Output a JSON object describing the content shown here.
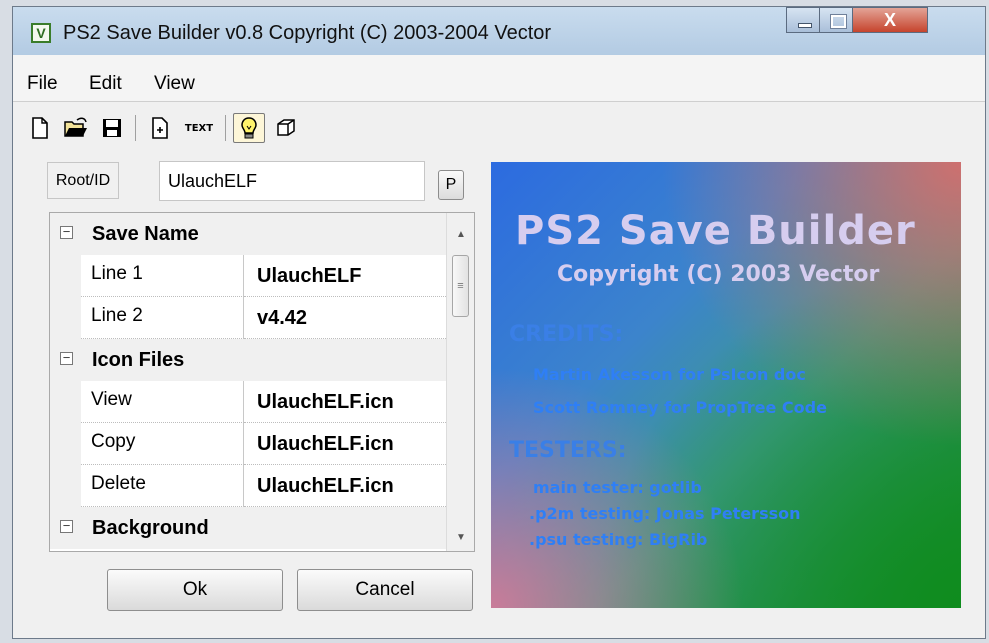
{
  "window": {
    "title": "PS2 Save Builder v0.8 Copyright (C) 2003-2004 Vector",
    "app_icon_letter": "V",
    "close_glyph": "X"
  },
  "menu": [
    "File",
    "Edit",
    "View"
  ],
  "toolbar": {
    "text_button_label": "TEXT",
    "icons": [
      "new-file-icon",
      "open-folder-icon",
      "save-icon",
      "new-item-icon",
      "text-icon",
      "lightbulb-icon",
      "cube-icon"
    ]
  },
  "root": {
    "label": "Root/ID",
    "value": "UlauchELF",
    "p_button": "P"
  },
  "properties": {
    "save_name": {
      "title": "Save Name",
      "rows": [
        {
          "name": "Line 1",
          "value": "UlauchELF"
        },
        {
          "name": "Line 2",
          "value": "v4.42"
        }
      ]
    },
    "icon_files": {
      "title": "Icon Files",
      "rows": [
        {
          "name": "View",
          "value": "UlauchELF.icn"
        },
        {
          "name": "Copy",
          "value": "UlauchELF.icn"
        },
        {
          "name": "Delete",
          "value": "UlauchELF.icn"
        }
      ]
    },
    "background": {
      "title": "Background"
    },
    "collapse_glyph": "−"
  },
  "buttons": {
    "ok": "Ok",
    "cancel": "Cancel"
  },
  "splash": {
    "title": "PS2 Save Builder",
    "copyright": "Copyright (C) 2003 Vector",
    "credits_heading": "CREDITS:",
    "credits": [
      "Martin Akesson for PsIcon doc",
      "Scott Romney for PropTree Code"
    ],
    "testers_heading": "TESTERS:",
    "testers": [
      "main tester: gotlib",
      ".p2m testing: Jonas Petersson",
      ".psu testing: BigRib"
    ]
  }
}
